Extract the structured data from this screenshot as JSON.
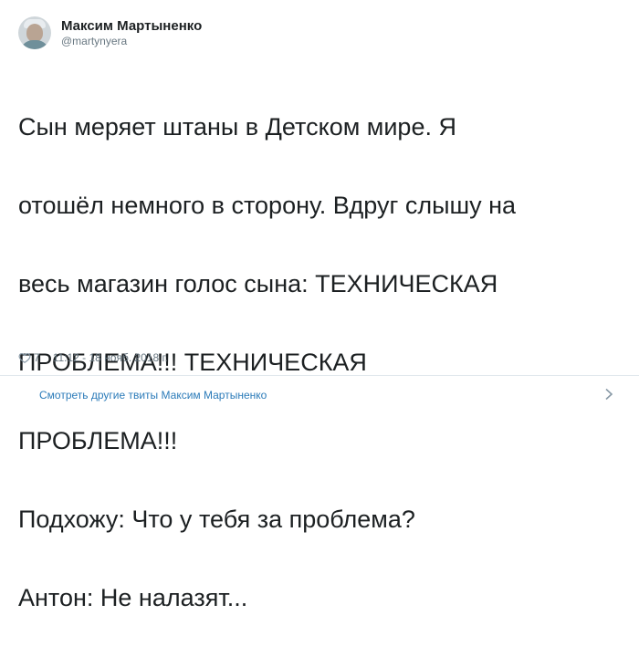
{
  "tweet": {
    "author": {
      "display_name": "Максим Мартыненко",
      "handle": "@martynyera"
    },
    "text_lines": [
      "Сын меряет штаны в Детском мире. Я",
      "отошёл немного в сторону. Вдруг слышу на",
      "весь магазин голос сына: ТЕХНИЧЕСКАЯ",
      "ПРОБЛЕМА!!! ТЕХНИЧЕСКАЯ",
      "ПРОБЛЕМА!!!",
      "Подхожу: Что у тебя за проблема?",
      "Антон:  Не налазят..."
    ],
    "likes": "7",
    "timestamp": "11:12 - 18 нояб. 2018 г.",
    "icons": {
      "like": "heart-outline-icon",
      "more": "chevron-right-icon"
    }
  },
  "footer": {
    "more_tweets_label": "Смотреть другие твиты Максим Мартыненко"
  },
  "colors": {
    "text": "#1c2022",
    "secondary": "#697882",
    "link": "#2b7bb9",
    "divider": "#e1e8ed"
  }
}
